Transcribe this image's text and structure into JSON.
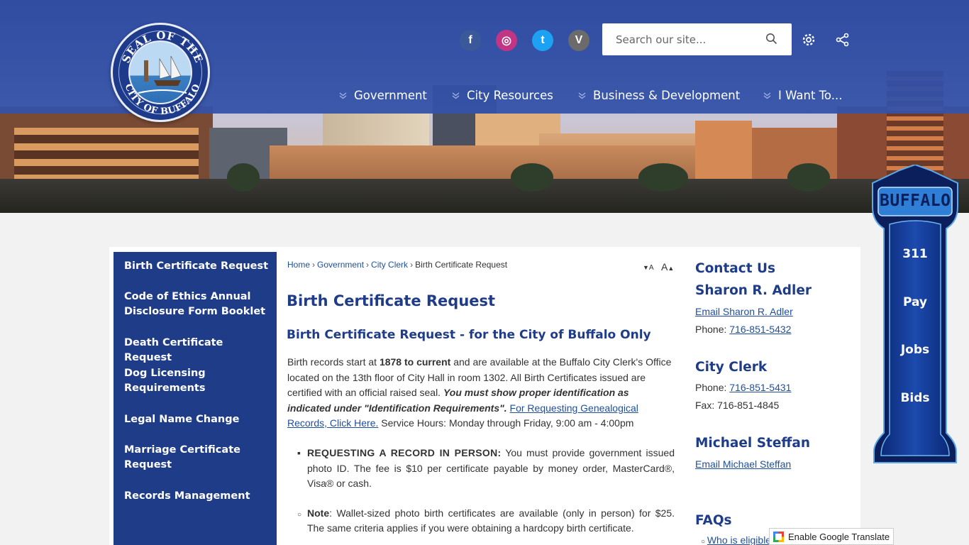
{
  "header": {
    "seal_text_top": "SEAL OF THE",
    "seal_text_bottom": "CITY OF BUFFALO",
    "search_placeholder": "Search our site...",
    "social": [
      {
        "icon": "facebook-icon",
        "glyph": "f",
        "color": "#3b5998"
      },
      {
        "icon": "instagram-icon",
        "glyph": "◎",
        "color": "#c13584"
      },
      {
        "icon": "twitter-icon",
        "glyph": "t",
        "color": "#1da1f2"
      },
      {
        "icon": "vimeo-icon",
        "glyph": "V",
        "color": "#6b6b6b"
      }
    ],
    "nav": [
      "Government",
      "City Resources",
      "Business & Development",
      "I Want To..."
    ]
  },
  "sidebar": {
    "items": [
      "Birth Certificate Request",
      "Code of Ethics Annual Disclosure Form Booklet",
      "Death Certificate Request",
      "Dog Licensing Requirements",
      "Legal Name Change",
      "Marriage Certificate Request",
      "Records Management"
    ]
  },
  "breadcrumb": {
    "home": "Home",
    "government": "Government",
    "clerk": "City Clerk",
    "current": "Birth Certificate Request",
    "separator": "›"
  },
  "font_controls": {
    "decrease": "A",
    "increase": "A"
  },
  "main": {
    "title": "Birth Certificate Request",
    "subtitle": "Birth Certificate Request - for the City of Buffalo Only",
    "para_1": "Birth records start at ",
    "para_bold_1": "1878 to current",
    "para_2": " and are available at the Buffalo City Clerk's Office located on the 13th floor of City Hall in room 1302. All Birth Certificates issued are certified with an official raised seal. ",
    "para_bold_italic": "You must show proper identification as indicated under \"Identification Requirements\".",
    "para_link": "For Requesting Genealogical Records, Click Here.",
    "para_3": " Service Hours:  Monday through Friday, 9:00 am - 4:00pm",
    "bullet_1_label": "REQUESTING A RECORD IN PERSON:",
    "bullet_1_text": " You must provide government issued photo ID.  The fee is $10 per certificate payable by money order, MasterCard®, Visa® or cash.",
    "bullet_2_label": "Note",
    "bullet_2_text": ": Wallet-sized photo birth certificates are available (only in person) for $25.  The same criteria applies if you were obtaining a hardcopy birth certificate."
  },
  "contact": {
    "heading": "Contact Us",
    "person_1": "Sharon R. Adler",
    "person_1_email": "Email Sharon R. Adler",
    "phone_label": "Phone: ",
    "person_1_phone": "716-851-5432",
    "dept": "City Clerk",
    "dept_phone": "716-851-5431",
    "fax_line": "Fax: 716-851-4845",
    "person_2": "Michael Steffan",
    "person_2_email": "Email Michael Steffan",
    "faqs": "FAQs",
    "faq_1": "Who is eligible"
  },
  "translate": {
    "label": "Enable Google Translate"
  },
  "quick_links": {
    "brand": "BUFFALO",
    "items": [
      "311",
      "Pay",
      "Jobs",
      "Bids"
    ]
  }
}
